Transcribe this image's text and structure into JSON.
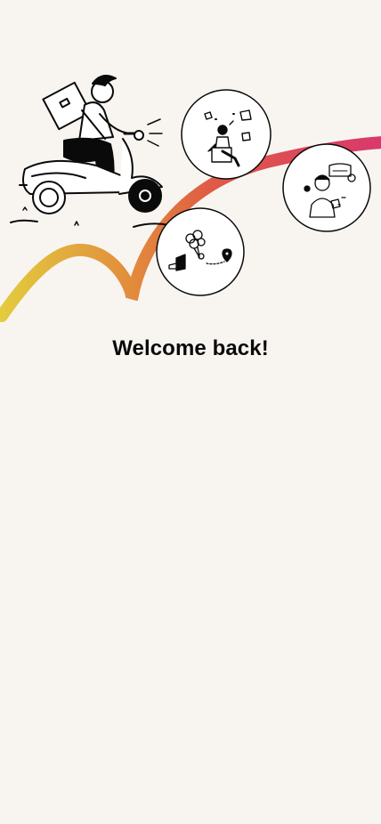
{
  "screen": {
    "title": "Welcome back!"
  },
  "illustrations": [
    "delivery-scooter-illustration",
    "shopping-person-illustration",
    "balloons-location-illustration",
    "finance-person-illustration"
  ],
  "colors": {
    "background": "#f8f5f1",
    "gradient_start": "#e3cb3e",
    "gradient_mid": "#e07a3e",
    "gradient_end": "#d9386d",
    "ink": "#0a0a0a"
  }
}
